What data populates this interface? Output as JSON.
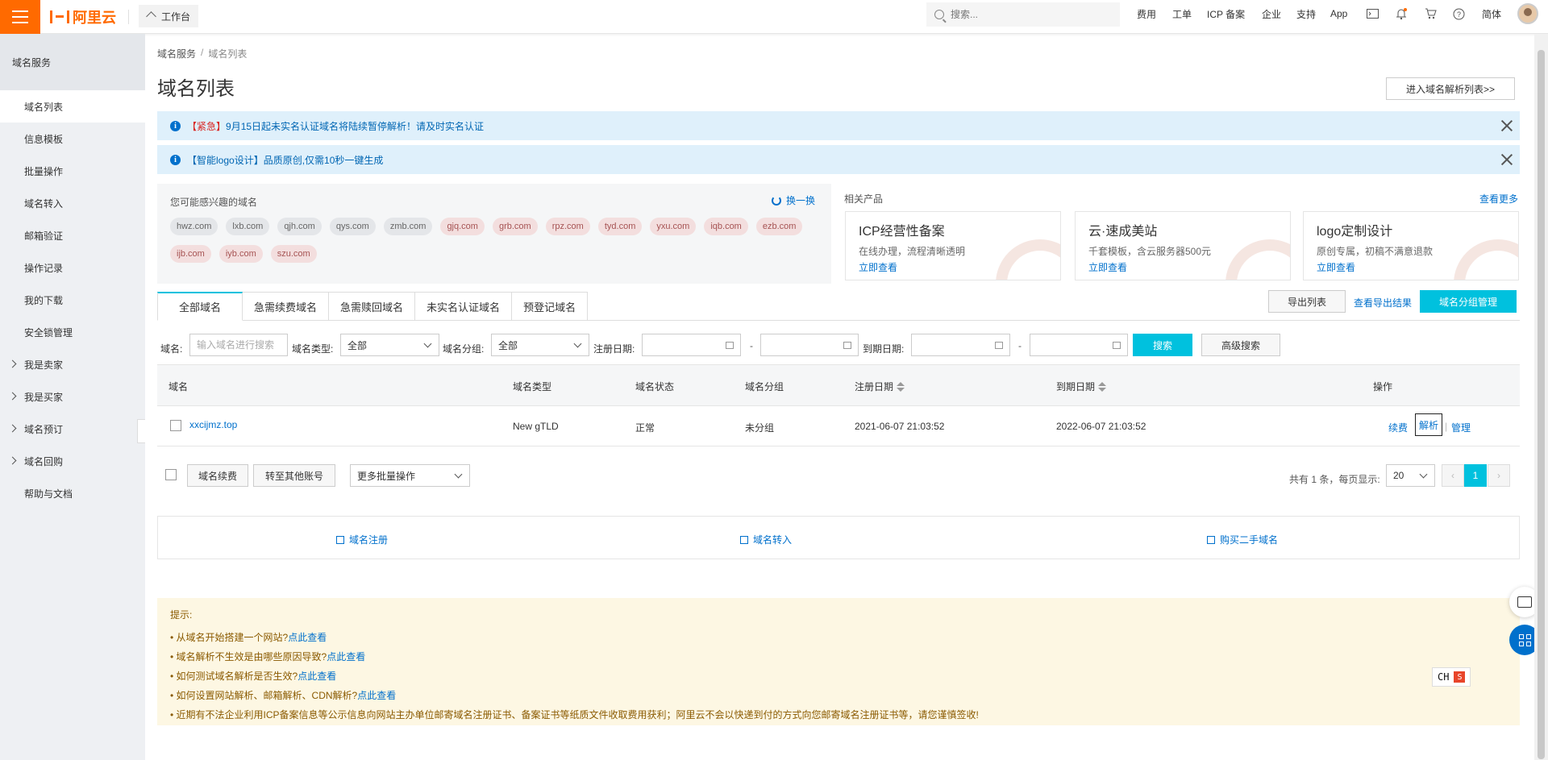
{
  "topbar": {
    "brand": "阿里云",
    "workbench": "工作台",
    "search_placeholder": "搜索...",
    "nav": [
      "费用",
      "工单",
      "ICP 备案",
      "企业",
      "支持",
      "App"
    ],
    "language": "简体"
  },
  "sidebar": {
    "title": "域名服务",
    "items": [
      {
        "label": "域名列表",
        "active": true
      },
      {
        "label": "信息模板"
      },
      {
        "label": "批量操作"
      },
      {
        "label": "域名转入"
      },
      {
        "label": "邮箱验证"
      },
      {
        "label": "操作记录"
      },
      {
        "label": "我的下载"
      },
      {
        "label": "安全锁管理"
      },
      {
        "label": "我是卖家",
        "expandable": true
      },
      {
        "label": "我是买家",
        "expandable": true
      },
      {
        "label": "域名预订",
        "expandable": true
      },
      {
        "label": "域名回购",
        "expandable": true
      },
      {
        "label": "帮助与文档"
      }
    ]
  },
  "breadcrumb": {
    "root": "域名服务",
    "sep": "/",
    "current": "域名列表"
  },
  "page_title": "域名列表",
  "enter_dns_button": "进入域名解析列表>>",
  "notices": [
    {
      "tag": "【紧急】",
      "text": "9月15日起未实名认证域名将陆续暂停解析！请及时实名认证"
    },
    {
      "tag": "",
      "text": "【智能logo设计】品质原创,仅需10秒一键生成"
    }
  ],
  "interest": {
    "title": "您可能感兴趣的域名",
    "refresh": "换一换",
    "chips": [
      {
        "name": "hwz.com",
        "pink": false
      },
      {
        "name": "lxb.com",
        "pink": false
      },
      {
        "name": "qjh.com",
        "pink": false
      },
      {
        "name": "qys.com",
        "pink": false
      },
      {
        "name": "zmb.com",
        "pink": false
      },
      {
        "name": "gjq.com",
        "pink": true
      },
      {
        "name": "grb.com",
        "pink": true
      },
      {
        "name": "rpz.com",
        "pink": true
      },
      {
        "name": "tyd.com",
        "pink": true
      },
      {
        "name": "yxu.com",
        "pink": true
      },
      {
        "name": "iqb.com",
        "pink": true
      },
      {
        "name": "ezb.com",
        "pink": true
      },
      {
        "name": "ijb.com",
        "pink": true
      },
      {
        "name": "iyb.com",
        "pink": true
      },
      {
        "name": "szu.com",
        "pink": true
      }
    ]
  },
  "related": {
    "title": "相关产品",
    "see_more": "查看更多",
    "products": [
      {
        "title": "ICP经营性备案",
        "desc": "在线办理，流程清晰透明",
        "link": "立即查看"
      },
      {
        "title": "云·速成美站",
        "desc": "千套模板，含云服务器500元",
        "link": "立即查看"
      },
      {
        "title": "logo定制设计",
        "desc": "原创专属，初稿不满意退款",
        "link": "立即查看"
      }
    ]
  },
  "tabs": [
    "全部域名",
    "急需续费域名",
    "急需赎回域名",
    "未实名认证域名",
    "预登记域名"
  ],
  "actions": {
    "export_list": "导出列表",
    "view_export": "查看导出结果",
    "group_manage": "域名分组管理"
  },
  "filters": {
    "domain_label": "域名:",
    "domain_placeholder": "输入域名进行搜索",
    "type_label": "域名类型:",
    "type_value": "全部",
    "group_label": "域名分组:",
    "group_value": "全部",
    "reg_label": "注册日期:",
    "exp_label": "到期日期:",
    "dash": "-",
    "search_button": "搜索",
    "advanced_button": "高级搜索"
  },
  "table": {
    "headers": [
      "域名",
      "域名类型",
      "域名状态",
      "域名分组",
      "注册日期",
      "到期日期",
      "操作"
    ],
    "rows": [
      {
        "domain": "xxcijmz.top",
        "type": "New gTLD",
        "status": "正常",
        "group": "未分组",
        "reg_date": "2021-06-07 21:03:52",
        "exp_date": "2022-06-07 21:03:52",
        "ops": [
          "续费",
          "解析",
          "管理"
        ]
      }
    ]
  },
  "footer_actions": {
    "renew": "域名续费",
    "transfer": "转至其他账号",
    "batch": "更多批量操作",
    "pager_text": "共有 1 条，每页显示:",
    "page_size": "20",
    "current_page": "1",
    "prev": "‹",
    "next": "›"
  },
  "quick": [
    "域名注册",
    "域名转入",
    "购买二手域名"
  ],
  "tips": {
    "title": "提示:",
    "items": [
      {
        "text": "• 从域名开始搭建一个网站?",
        "link": "点此查看"
      },
      {
        "text": "• 域名解析不生效是由哪些原因导致?",
        "link": "点此查看"
      },
      {
        "text": "• 如何测试域名解析是否生效?",
        "link": "点此查看"
      },
      {
        "text": "• 如何设置网站解析、邮箱解析、CDN解析?",
        "link": "点此查看"
      },
      {
        "text": "• 近期有不法企业利用ICP备案信息等公示信息向网站主办单位邮寄域名注册证书、备案证书等纸质文件收取费用获利；阿里云不会以快递到付的方式向您邮寄域名注册证书等，请您谨慎签收!",
        "link": ""
      }
    ]
  },
  "ime": {
    "label": "CH"
  },
  "colors": {
    "brand": "#ff6a00",
    "accent": "#00c1de",
    "link": "#0070cc"
  }
}
